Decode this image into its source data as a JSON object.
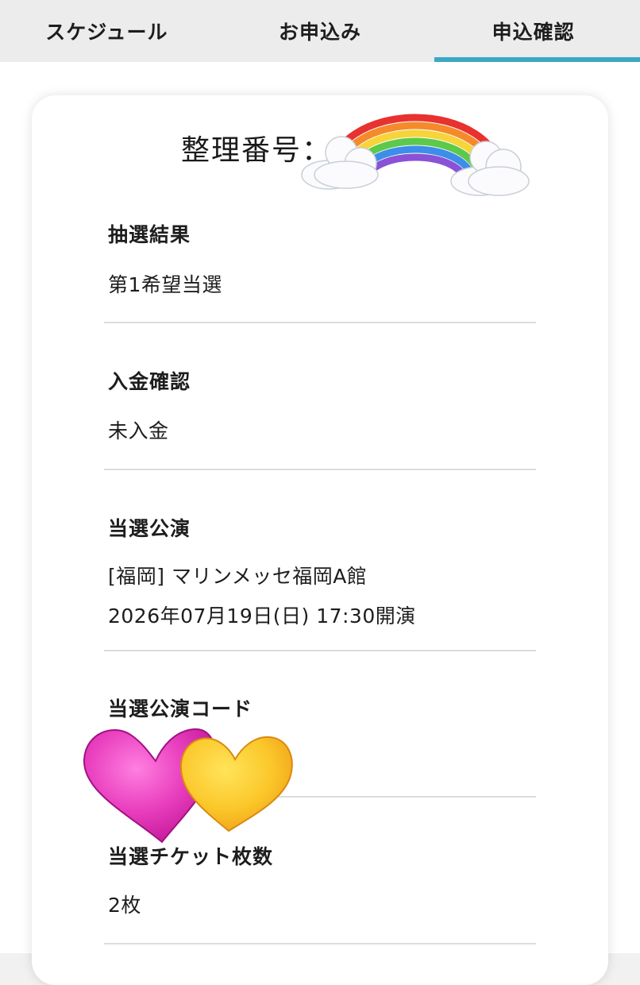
{
  "tabs": [
    {
      "label": "スケジュール",
      "active": false
    },
    {
      "label": "お申込み",
      "active": false
    },
    {
      "label": "申込確認",
      "active": true
    }
  ],
  "accent_color": "#3ba8c5",
  "header": {
    "seiri_label": "整理番号："
  },
  "sections": [
    {
      "label": "抽選結果",
      "value": "第1希望当選"
    },
    {
      "label": "入金確認",
      "value": "未入金"
    },
    {
      "label": "当選公演",
      "value_lines": [
        "[福岡] マリンメッセ福岡A館",
        "2026年07月19日(日) 17:30開演"
      ]
    },
    {
      "label": "当選公演コード",
      "value": ""
    },
    {
      "label": "当選チケット枚数",
      "value": "2枚"
    }
  ],
  "stickers": [
    "rainbow-emoji",
    "two-hearts-emoji"
  ]
}
